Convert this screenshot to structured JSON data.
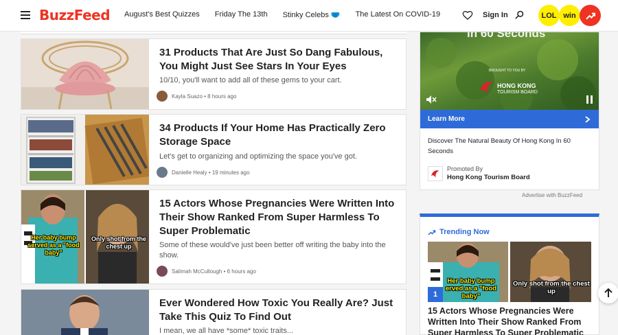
{
  "header": {
    "logo": "BuzzFeed",
    "nav": [
      "August's Best Quizzes",
      "Friday The 13th",
      "Stinky Celebs 🩲",
      "The Latest On COVID-19"
    ],
    "signin": "Sign In",
    "badges": {
      "lol": "LOL",
      "win": "win"
    }
  },
  "articles": [
    {
      "title": "31 Products That Are Just So Dang Fabulous, You Might Just See Stars In Your Eyes",
      "desc": "10/10, you'll want to add all of these gems to your cart.",
      "author": "Kayla Suazo",
      "time": "• 8 hours ago"
    },
    {
      "title": "34 Products If Your Home Has Practically Zero Storage Space",
      "desc": "Let's get to organizing and optimizing the space you've got.",
      "author": "Danielle Healy",
      "time": "• 19 minutes ago"
    },
    {
      "title": "15 Actors Whose Pregnancies Were Written Into Their Show Ranked From Super Harmless To Super Problematic",
      "desc": "Some of these would've just been better off writing the baby into the show.",
      "author": "Salimah McCullough",
      "time": "• 6 hours ago",
      "caption_left": "Her baby bump served as a \"food baby\"",
      "caption_right": "Only shot from the chest up"
    },
    {
      "title": "Ever Wondered How Toxic You Really Are? Just Take This Quiz To Find Out",
      "desc": "I mean, we all have *some* toxic traits..."
    }
  ],
  "ad": {
    "video_text": "in 60 Seconds",
    "brought_by": "BROUGHT TO YOU BY",
    "brand_line1": "HONG KONG",
    "brand_line2": "TOURISM BOARD",
    "learn_more": "Learn More",
    "title": "Discover The Natural Beauty Of Hong Kong In 60 Seconds",
    "promoted_by": "Promoted By",
    "sponsor": "Hong Kong Tourism Board",
    "advertise": "Advertise with BuzzFeed"
  },
  "trending": {
    "heading": "Trending Now",
    "rank": "1",
    "title": "15 Actors Whose Pregnancies Were Written Into Their Show Ranked From Super Harmless To Super Problematic",
    "caption_left": "Her baby bump erved as a \"food baby\"",
    "caption_right": "Only shot from the chest up"
  },
  "colors": {
    "brand": "#ee3322",
    "accent": "#2f6bd8",
    "badge": "#ffee00"
  }
}
